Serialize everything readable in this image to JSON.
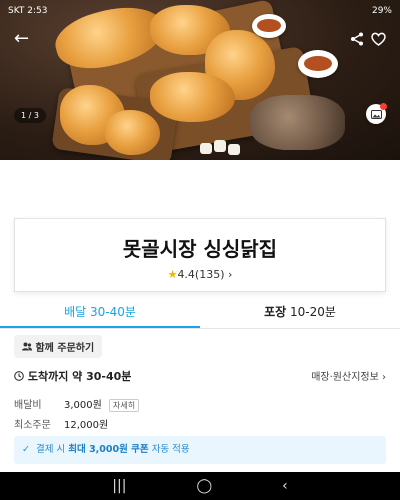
{
  "status_bar": {
    "time": "SKT 2:53",
    "right": "29%"
  },
  "hero": {
    "pager": "1 / 3"
  },
  "store": {
    "name": "못골시장 싱싱닭집",
    "rating": "4.4(135)"
  },
  "tabs": [
    {
      "label": "배달",
      "time": "30-40분",
      "active": true
    },
    {
      "label": "포장",
      "time": "10-20분",
      "active": false
    }
  ],
  "group_order": "함께 주문하기",
  "arrival": "도착까지 약 30-40분",
  "origin_info": "매장·원산지정보",
  "delivery_fee": {
    "label": "배달비",
    "value": "3,000원",
    "detail": "자세히"
  },
  "min_order": {
    "label": "최소주문",
    "value": "12,000원"
  },
  "coupon": {
    "prefix": "결제 시",
    "highlight": "최대 3,000원 쿠폰",
    "suffix": "자동 적용"
  },
  "accent_color": "#1aa3e6"
}
